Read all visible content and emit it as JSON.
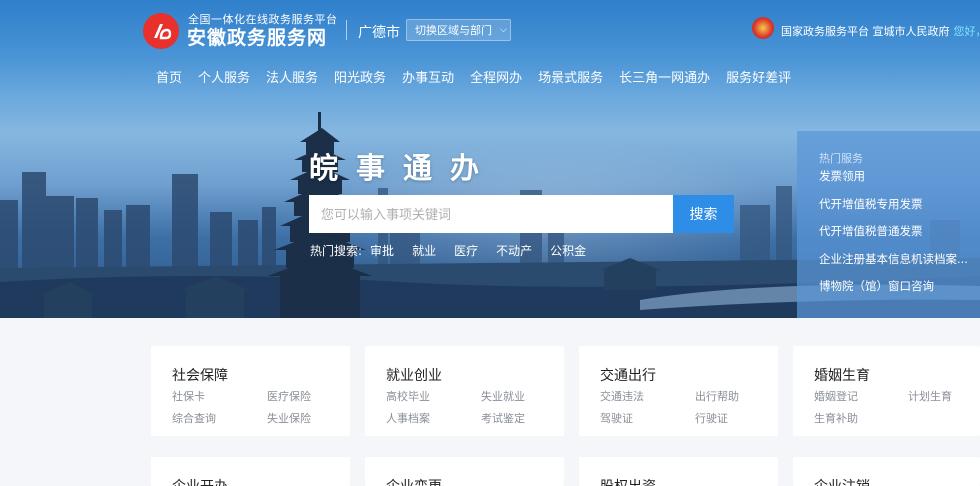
{
  "header": {
    "logo_small": "全国一体化在线政务服务平台",
    "logo_big": "安徽政务服务网",
    "city": "广德市",
    "switch_label": "切换区域与部门",
    "top_links": "国家政务服务平台 宣城市人民政府",
    "hello": "您好，"
  },
  "nav": {
    "items": [
      "首页",
      "个人服务",
      "法人服务",
      "阳光政务",
      "办事互动",
      "全程网办",
      "场景式服务",
      "长三角一网通办",
      "服务好差评"
    ]
  },
  "hero": {
    "slogan": "皖事通办",
    "search_placeholder": "您可以输入事项关键词",
    "search_button": "搜索",
    "hot_label": "热门搜索:",
    "hot_items": [
      "审批",
      "就业",
      "医疗",
      "不动产",
      "公积金"
    ]
  },
  "side_panel": {
    "title": "热门服务",
    "items": [
      "发票领用",
      "代开增值税专用发票",
      "代开增值税普通发票",
      "企业注册基本信息机读档案...",
      "博物院（馆）窗口咨询"
    ]
  },
  "cards": [
    {
      "title": "社会保障",
      "links": [
        "社保卡",
        "医疗保险",
        "综合查询",
        "失业保险"
      ]
    },
    {
      "title": "就业创业",
      "links": [
        "高校毕业",
        "失业就业",
        "人事档案",
        "考试鉴定"
      ]
    },
    {
      "title": "交通出行",
      "links": [
        "交通违法",
        "出行帮助",
        "驾驶证",
        "行驶证"
      ]
    },
    {
      "title": "婚姻生育",
      "links": [
        "婚姻登记",
        "计划生育",
        "生育补助"
      ]
    },
    {
      "title": "企业开办",
      "links": []
    },
    {
      "title": "企业变更",
      "links": []
    },
    {
      "title": "股权出资",
      "links": []
    },
    {
      "title": "企业注销",
      "links": []
    }
  ],
  "colors": {
    "accent": "#2e8de6",
    "logo_red": "#e8302c",
    "hello_cyan": "#7fe3ff"
  }
}
